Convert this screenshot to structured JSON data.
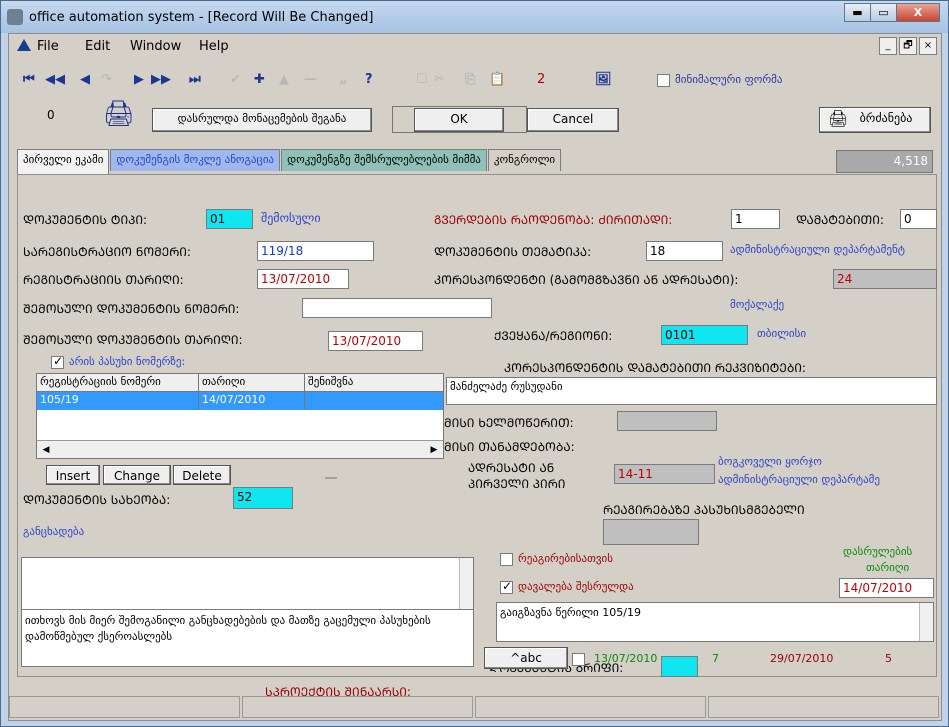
{
  "window": {
    "title": "office automation system - [Record Will Be Changed]",
    "min": "▬",
    "max": "▭",
    "close": "X"
  },
  "menu": {
    "file": "File",
    "edit": "Edit",
    "window": "Window",
    "help": "Help",
    "mdi_min": "_",
    "mdi_restore": "🗗",
    "mdi_close": "×"
  },
  "toolbar": {
    "count": "2",
    "minimal_form": "მინიმალური ფორმა",
    "nav": [
      "⏮",
      "◀◀",
      "◀",
      "↷",
      "▶",
      "▶▶",
      "⏭"
    ],
    "actions": [
      "✔",
      "✚",
      "▲",
      "—",
      "„",
      "?"
    ],
    "extras": [
      "☐",
      "✂",
      "⎘",
      "📋",
      "🖼"
    ]
  },
  "row2": {
    "value": "0",
    "finished_label": "დასრულდა მონაცემების შეგანა",
    "ok": "OK",
    "cancel": "Cancel",
    "print": "ბრძანება"
  },
  "tabs": [
    {
      "label": "პირველი ეკამი"
    },
    {
      "label": "დოკუმენგის მოკლე ანოგაცია"
    },
    {
      "label": "დოკუმენგზე შემსრულებლების მიმმა"
    },
    {
      "label": "კონგროლი"
    }
  ],
  "counter": "4,518",
  "form": {
    "doc_type_label": "ᲓᲝᲙᲣᲛᲔᲜᲢᲘᲡ ᲢᲘᲞᲘ:",
    "doc_type_value": "01",
    "doc_type_text": "შემოსული",
    "pages_label": "ᲒᲕᲔᲠᲓᲔᲑᲘᲡ ᲠᲐᲝᲓᲔᲜᲝᲑᲐ: ᲫᲘᲠᲘᲗᲐᲓᲘ:",
    "pages_main": "1",
    "extra_label": "ᲓᲐᲛᲐᲢᲔᲑᲘᲗᲘ:",
    "extra_value": "0",
    "reg_no_label": "ᲡᲐᲠᲔᲒᲘᲡᲢᲠᲐᲪᲘᲝ ᲜᲝᲛᲔᲠᲘ:",
    "reg_no_value": "119/18",
    "topic_label": "ᲓᲝᲙᲣᲛᲔᲜᲢᲘᲡ ᲗᲔᲛᲐᲢᲘᲙᲐ:",
    "topic_value": "18",
    "topic_text": "ადმინისტრაციული დეპარტამენტ",
    "reg_date_label": "ᲠᲔᲒᲘᲡᲢᲠᲐᲪᲘᲘᲡ ᲗᲐᲠᲘᲦᲘ:",
    "reg_date_value": "13/07/2010",
    "corr_label": "ᲙᲝᲠᲔᲡᲞᲝᲜᲓᲔᲜᲢᲘ (ᲒᲐᲛᲝᲛᲒᲖᲐᲕᲜᲘ ᲐᲜ ᲐᲓᲠᲔᲡᲐᲢᲘ):",
    "corr_value": "24",
    "corr_text": "მოქალაქე",
    "in_no_label": "ᲨᲔᲛᲝᲡᲣᲚᲘ ᲓᲝᲙᲣᲛᲔᲜᲢᲘᲡ ᲜᲝᲛᲔᲠᲘ:",
    "in_date_label": "ᲨᲔᲛᲝᲡᲣᲚᲘ ᲓᲝᲙᲣᲛᲔᲜᲢᲘᲡ ᲗᲐᲠᲘᲦᲘ:",
    "in_date_value": "13/07/2010",
    "country_label": "ᲥᲕᲔᲧᲐᲜᲐ/ᲠᲔᲒᲘᲝᲜᲘ:",
    "country_value": "0101",
    "country_text": "თბილისი",
    "answer_check": "არის პასუხი ნომერზე:",
    "corr_details_label": "ᲙᲝᲠᲔᲡᲞᲝᲜᲓᲔᲜᲢᲘᲡ ᲓᲐᲛᲐᲢᲔᲑᲘᲗᲘ ᲠᲔᲙᲕᲘᲖᲘᲢᲔᲑᲘ:",
    "corr_details_value": "მანძელაძე რუსუდანი",
    "grid_headers": [
      "რეგისტრაციის ნომერი",
      "თარიღი",
      "შენიშვნა"
    ],
    "grid_rows": [
      [
        "105/19",
        "14/07/2010",
        ""
      ]
    ],
    "mobile_label": "ᲛᲘᲡᲘ ᲮᲔᲚᲛᲝᲬᲔᲠᲘᲗ:",
    "position_label": "ᲛᲘᲡᲘ ᲗᲐᲜᲐᲛᲓᲔᲑᲝᲑᲐ:",
    "insert": "Insert",
    "change": "Change",
    "delete": "Delete",
    "address_label_1": "ᲐᲓᲠᲔᲡᲐᲢᲘ ᲐᲜ",
    "address_label_2": "ᲞᲘᲠᲕᲔᲚᲘ ᲞᲘᲠᲘ",
    "address_value": "14-11",
    "address_text_1": "ბოგკოველი ყორჯო",
    "address_text_2": "ადმინისტრაციული დეპარტამე",
    "doc_status_label": "ᲓᲝᲙᲣᲛᲔᲜᲢᲘᲡ ᲡᲐᲮᲔᲝᲑᲐ:",
    "doc_status_value": "52",
    "responsible_label": "ᲠᲔᲐᲒᲘᲠᲔᲑᲐᲖᲔ ᲞᲐᲡᲣᲮᲘᲡᲛᲒᲔᲑᲔᲚᲘ",
    "statement_label": "განცხადება",
    "for_reaction": "რეაგირებისათვის",
    "completed_date_label_1": "დასრულების",
    "completed_date_label_2": "თარიღი",
    "task_done": "დავალება შესრულდა",
    "completed_date_value": "14/07/2010",
    "desc_text": "ითხოვს მის მიერ შემოგანილი განცხადებების და მათზე გაცემული პასუხების დამოწმებულ ქსეროასლებს",
    "sent_text": "გაიგზავნა წერილი 105/19",
    "doc_group_label": "ᲓᲝᲙᲣᲛᲔᲜᲢᲘᲡ ᲒᲠᲘᲤᲘ:",
    "abc_btn": "^abc",
    "date1": "13/07/2010",
    "num1": "7",
    "date2": "29/07/2010",
    "num2": "5"
  },
  "project_label": "ᲡᲞᲠᲝᲔᲥᲢᲘᲡ ᲨᲘᲜᲐᲐᲠᲡᲘ:"
}
